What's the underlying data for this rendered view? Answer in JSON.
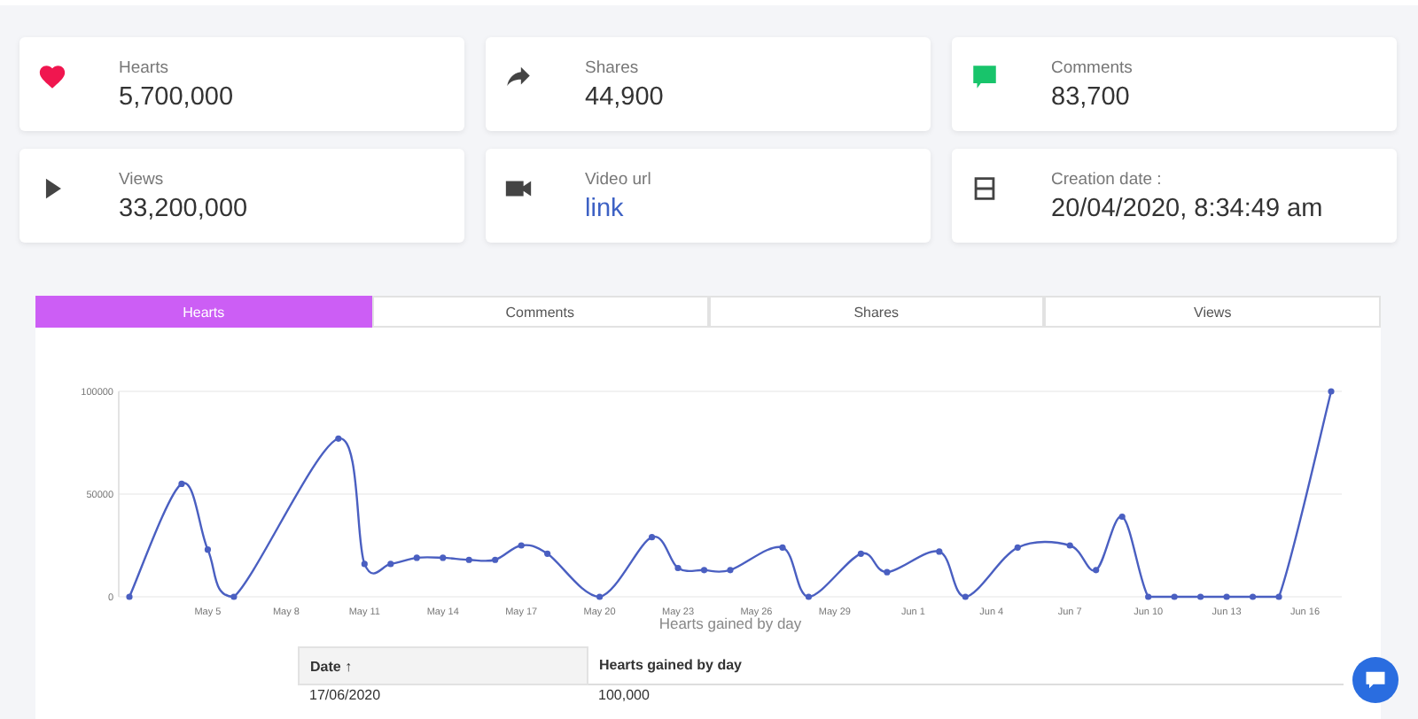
{
  "stats": [
    {
      "kind": "heart",
      "label": "Hearts",
      "value": "5,700,000"
    },
    {
      "kind": "share",
      "label": "Shares",
      "value": "44,900"
    },
    {
      "kind": "comment",
      "label": "Comments",
      "value": "83,700"
    },
    {
      "kind": "play",
      "label": "Views",
      "value": "33,200,000"
    },
    {
      "kind": "video",
      "label": "Video url",
      "value": "link"
    },
    {
      "kind": "calendar",
      "label": "Creation date :",
      "value": "20/04/2020, 8:34:49 am"
    }
  ],
  "tabs": [
    {
      "label": "Hearts",
      "selected": true
    },
    {
      "label": "Comments",
      "selected": false
    },
    {
      "label": "Shares",
      "selected": false
    },
    {
      "label": "Views",
      "selected": false
    }
  ],
  "chart": {
    "chart_data": {
      "type": "line",
      "xlabel": "Hearts gained by day",
      "categories": [
        null,
        null,
        null,
        "May 5",
        null,
        null,
        "May 8",
        null,
        null,
        "May 11",
        null,
        null,
        "May 14",
        null,
        null,
        "May 17",
        null,
        null,
        "May 20",
        null,
        null,
        "May 23",
        null,
        null,
        "May 26",
        null,
        null,
        "May 29",
        null,
        null,
        "Jun 1",
        null,
        null,
        "Jun 4",
        null,
        null,
        "Jun 7",
        null,
        null,
        "Jun 10",
        null,
        null,
        "Jun 13",
        null,
        null,
        "Jun 16",
        null
      ],
      "series": [
        {
          "color": "#4a5fc1",
          "marker": true,
          "values": [
            0,
            null,
            55000,
            23000,
            0,
            null,
            null,
            null,
            77000,
            16000,
            16000,
            19000,
            19000,
            18000,
            18000,
            25000,
            21000,
            null,
            0,
            null,
            29000,
            14000,
            13000,
            13000,
            null,
            24000,
            0,
            null,
            21000,
            12000,
            null,
            22000,
            0,
            null,
            24000,
            null,
            25000,
            13000,
            39000,
            0,
            0,
            0,
            0,
            0,
            0,
            null,
            100000
          ]
        }
      ],
      "ylim": [
        0,
        100000
      ],
      "yticks": [
        0,
        50000,
        100000
      ]
    }
  },
  "table": {
    "columns": [
      "Date ↑",
      "Hearts gained by day"
    ],
    "rows": [
      [
        "17/06/2020",
        "100,000"
      ]
    ]
  }
}
